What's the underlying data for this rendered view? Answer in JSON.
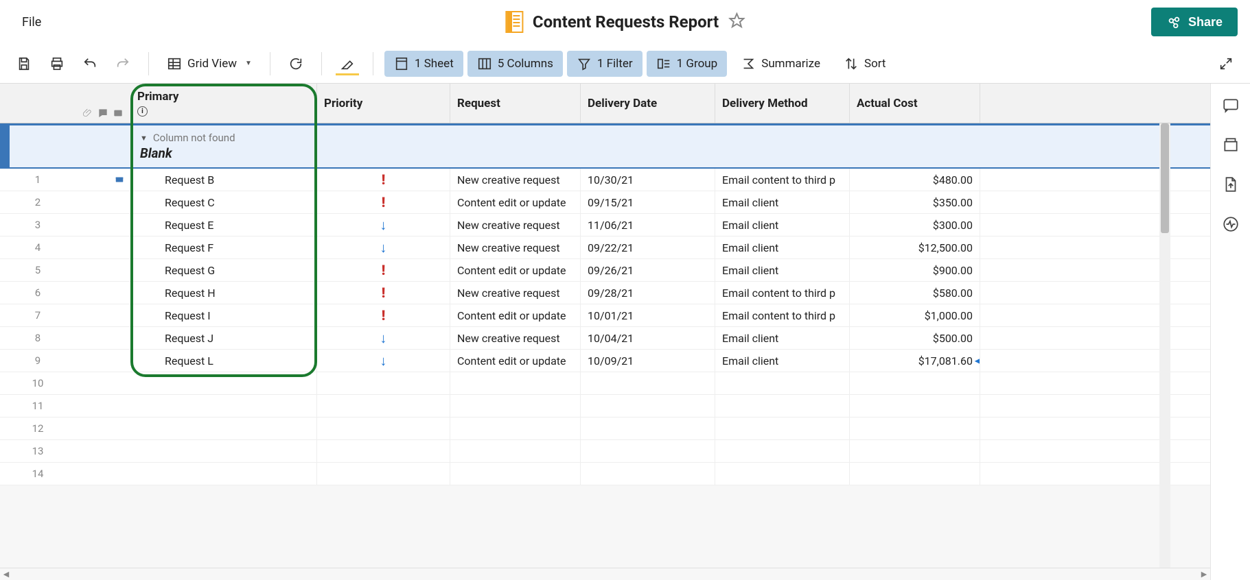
{
  "menu": {
    "file": "File"
  },
  "document": {
    "title": "Content Requests Report"
  },
  "share": {
    "label": "Share"
  },
  "toolbar": {
    "grid_view": "Grid View",
    "sheet": "1 Sheet",
    "columns": "5 Columns",
    "filter": "1 Filter",
    "group": "1 Group",
    "summarize": "Summarize",
    "sort": "Sort"
  },
  "columns": {
    "primary": "Primary",
    "priority": "Priority",
    "request": "Request",
    "delivery_date": "Delivery Date",
    "delivery_method": "Delivery Method",
    "actual_cost": "Actual Cost"
  },
  "group_header": {
    "warning": "Column not found",
    "value": "Blank"
  },
  "rows": [
    {
      "n": "1",
      "primary": "Request B",
      "priority": "high",
      "request": "New creative request",
      "date": "10/30/21",
      "method": "Email content to third p",
      "cost": "$480.00",
      "card": true
    },
    {
      "n": "2",
      "primary": "Request C",
      "priority": "high",
      "request": "Content edit or update",
      "date": "09/15/21",
      "method": "Email client",
      "cost": "$350.00"
    },
    {
      "n": "3",
      "primary": "Request E",
      "priority": "low",
      "request": "New creative request",
      "date": "11/06/21",
      "method": "Email client",
      "cost": "$300.00"
    },
    {
      "n": "4",
      "primary": "Request F",
      "priority": "low",
      "request": "New creative request",
      "date": "09/22/21",
      "method": "Email client",
      "cost": "$12,500.00"
    },
    {
      "n": "5",
      "primary": "Request G",
      "priority": "high",
      "request": "Content edit or update",
      "date": "09/26/21",
      "method": "Email client",
      "cost": "$900.00"
    },
    {
      "n": "6",
      "primary": "Request H",
      "priority": "high",
      "request": "New creative request",
      "date": "09/28/21",
      "method": "Email content to third p",
      "cost": "$580.00"
    },
    {
      "n": "7",
      "primary": "Request I",
      "priority": "high",
      "request": "Content edit or update",
      "date": "10/01/21",
      "method": "Email content to third p",
      "cost": "$1,000.00"
    },
    {
      "n": "8",
      "primary": "Request J",
      "priority": "low",
      "request": "New creative request",
      "date": "10/04/21",
      "method": "Email client",
      "cost": "$500.00"
    },
    {
      "n": "9",
      "primary": "Request L",
      "priority": "low",
      "request": "Content edit or update",
      "date": "10/09/21",
      "method": "Email client",
      "cost": "$17,081.60",
      "overflow": true
    }
  ],
  "empty_rows": [
    "10",
    "11",
    "12",
    "13",
    "14"
  ]
}
